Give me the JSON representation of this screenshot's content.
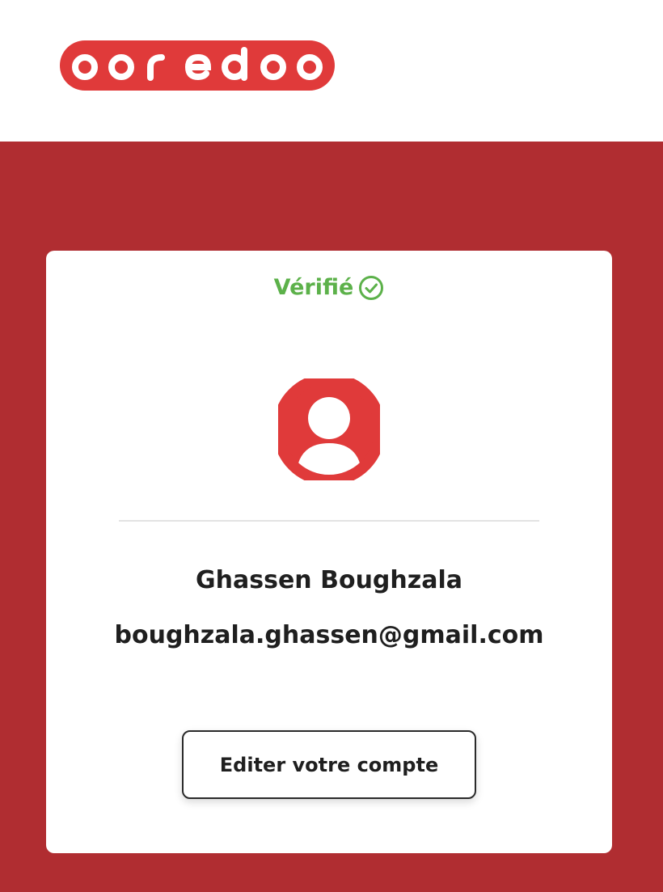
{
  "brand": {
    "name": "ooredoo",
    "color": "#e03a3a",
    "background": "#b02d31"
  },
  "profile": {
    "status_label": "Vérifié",
    "status_color": "#5cb14a",
    "status_icon": "check-circle-icon",
    "avatar_icon": "user-avatar-icon",
    "name": "Ghassen Boughzala",
    "email": "boughzala.ghassen@gmail.com",
    "edit_button_label": "Editer votre compte"
  }
}
